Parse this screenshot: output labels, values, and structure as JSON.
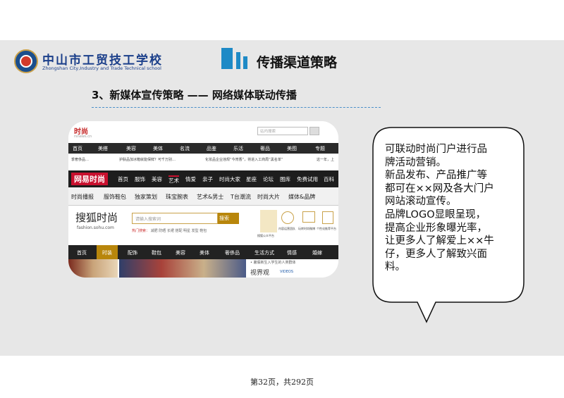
{
  "header": {
    "school_name_cn": "中山市工贸技工学校",
    "school_name_en": "Zhongshan City,Industry and Trade Technical school",
    "section_title": "传播渠道策略"
  },
  "subtitle": "3、新媒体宣传策略 —— 网络媒体联动传播",
  "screenshot": {
    "top_logo": "时尚",
    "top_logo_sub": "rsnews.cn",
    "top_search_placeholder": "站内搜索",
    "nav1": [
      "首页",
      "美搭",
      "美容",
      "美体",
      "名流",
      "品鉴",
      "乐活",
      "奢品",
      "美图",
      "专题"
    ],
    "ticker": [
      "季奢侈品…",
      "护肤品加冰箱就能保鲜？可千万别…",
      "化妆品企业违规“今宵香”，将进入工商局“黑名单”",
      "这一年，上"
    ],
    "brand_163": "网易时尚",
    "nav2": [
      "首页",
      "服饰",
      "美容",
      "艺术",
      "情爱",
      "亲子",
      "时尚大家",
      "星座",
      "论坛",
      "图库",
      "免费试用",
      "百科"
    ],
    "nav3": [
      "时尚播报",
      "服饰鞋包",
      "独家策划",
      "珠宝腕表",
      "艺术&男士",
      "T台潮流",
      "时尚大片",
      "媒体&品牌"
    ],
    "sohu_logo": "搜狐时尚",
    "sohu_url": "fashion.sohu.com",
    "sohu_search_placeholder": "请输入搜索词",
    "sohu_search_button": "搜索",
    "hot_label": "热门搜索：",
    "hot_words": [
      "减肥",
      "防晒",
      "长裙",
      "搭配",
      "明星",
      "发型",
      "鞋包"
    ],
    "service_labels": [
      "搜狐公众平台",
      "内容运营团队",
      "玩转时尚微博",
      "个性化推荐平台"
    ],
    "nav4": [
      "首页",
      "时装",
      "配饰",
      "鞋包",
      "美容",
      "美体",
      "奢侈品",
      "生活方式",
      "情感",
      "婚嫁"
    ],
    "bottom_text": "• 暑假新生入学生的人类群体",
    "video_label": "视界观",
    "video_en": "VIDEOS"
  },
  "bubble": {
    "lines": [
      "可联动时尚门户进行品",
      "牌活动营销。",
      "新品发布、产品推广等",
      "都可在××网及各大门户",
      "网站滚动宣传。",
      "品牌LOGO显眼呈现，",
      "提高企业形象曝光率，",
      "让更多人了解爱上××牛",
      "仔，更多人了解致兴面",
      "料。"
    ]
  },
  "footer": "第32页，共292页",
  "colors": {
    "accent_blue": "#1e8ac6",
    "school_blue": "#1b3f8a",
    "slide_bg": "#e7e7e7",
    "netease_red": "#c8102e",
    "sohu_gold": "#b8860b"
  }
}
